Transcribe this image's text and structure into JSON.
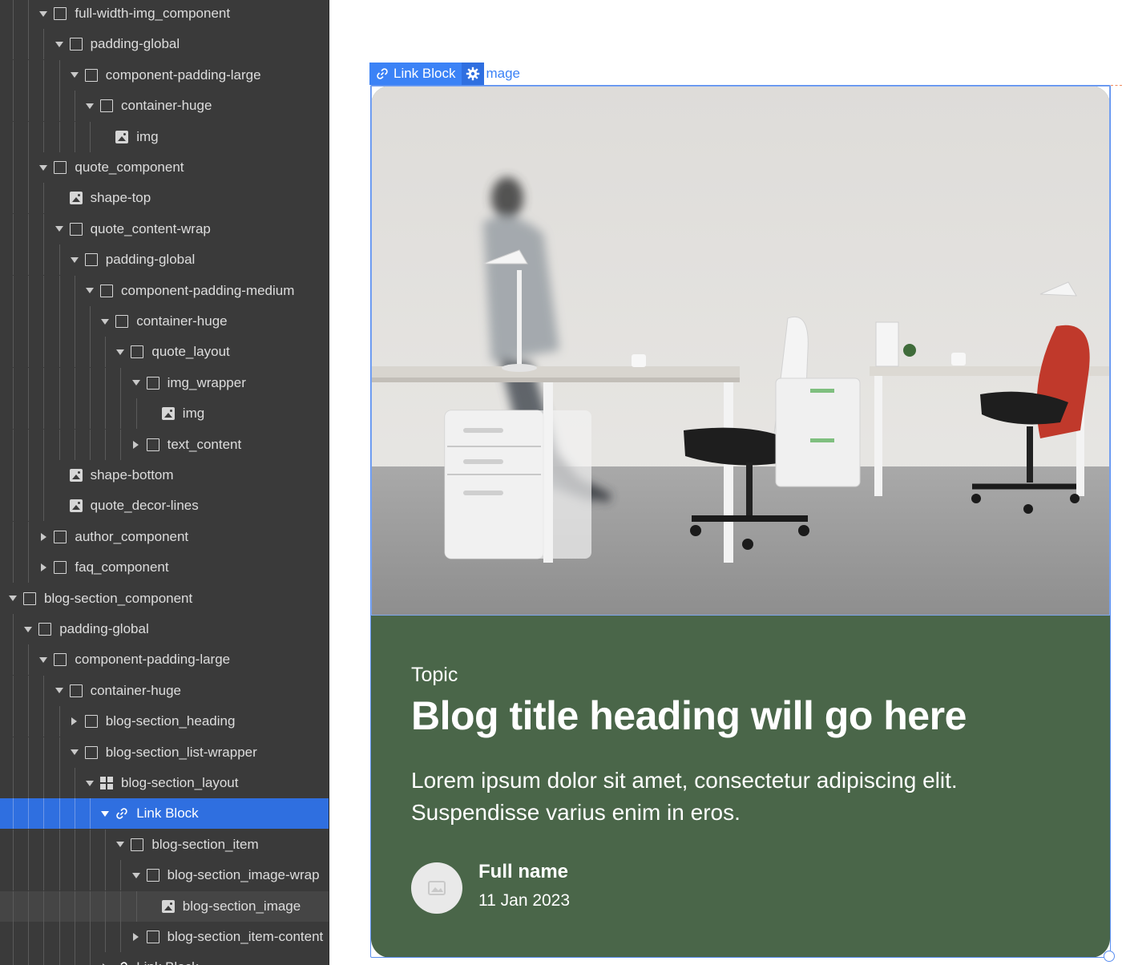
{
  "navigator": {
    "rows": [
      {
        "label": "full-width-img_component",
        "icon": "box-icon",
        "toggle": "down"
      },
      {
        "label": "padding-global",
        "icon": "box-icon",
        "toggle": "down"
      },
      {
        "label": "component-padding-large",
        "icon": "box-icon",
        "toggle": "down"
      },
      {
        "label": "container-huge",
        "icon": "box-icon",
        "toggle": "down"
      },
      {
        "label": "img",
        "icon": "image-icon",
        "toggle": "none"
      },
      {
        "label": "quote_component",
        "icon": "box-icon",
        "toggle": "down"
      },
      {
        "label": "shape-top",
        "icon": "image-icon",
        "toggle": "none"
      },
      {
        "label": "quote_content-wrap",
        "icon": "box-icon",
        "toggle": "down"
      },
      {
        "label": "padding-global",
        "icon": "box-icon",
        "toggle": "down"
      },
      {
        "label": "component-padding-medium",
        "icon": "box-icon",
        "toggle": "down"
      },
      {
        "label": "container-huge",
        "icon": "box-icon",
        "toggle": "down"
      },
      {
        "label": "quote_layout",
        "icon": "box-icon",
        "toggle": "down"
      },
      {
        "label": "img_wrapper",
        "icon": "box-icon",
        "toggle": "down"
      },
      {
        "label": "img",
        "icon": "image-icon",
        "toggle": "none"
      },
      {
        "label": "text_content",
        "icon": "box-icon",
        "toggle": "right"
      },
      {
        "label": "shape-bottom",
        "icon": "image-icon",
        "toggle": "none"
      },
      {
        "label": "quote_decor-lines",
        "icon": "image-icon",
        "toggle": "none"
      },
      {
        "label": "author_component",
        "icon": "box-icon",
        "toggle": "right"
      },
      {
        "label": "faq_component",
        "icon": "box-icon",
        "toggle": "right"
      },
      {
        "label": "blog-section_component",
        "icon": "box-icon",
        "toggle": "down"
      },
      {
        "label": "padding-global",
        "icon": "box-icon",
        "toggle": "down"
      },
      {
        "label": "component-padding-large",
        "icon": "box-icon",
        "toggle": "down"
      },
      {
        "label": "container-huge",
        "icon": "box-icon",
        "toggle": "down"
      },
      {
        "label": "blog-section_heading",
        "icon": "box-icon",
        "toggle": "right"
      },
      {
        "label": "blog-section_list-wrapper",
        "icon": "box-icon",
        "toggle": "down"
      },
      {
        "label": "blog-section_layout",
        "icon": "grid-icon",
        "toggle": "down"
      },
      {
        "label": "Link Block",
        "icon": "link-icon",
        "toggle": "down",
        "state": "selected"
      },
      {
        "label": "blog-section_item",
        "icon": "box-icon",
        "toggle": "down"
      },
      {
        "label": "blog-section_image-wrap",
        "icon": "box-icon",
        "toggle": "down"
      },
      {
        "label": "blog-section_image",
        "icon": "image-icon",
        "toggle": "none",
        "state": "hovered"
      },
      {
        "label": "blog-section_item-content",
        "icon": "box-icon",
        "toggle": "right"
      },
      {
        "label": "Link Block",
        "icon": "link-icon",
        "toggle": "right"
      }
    ]
  },
  "canvas": {
    "badge": {
      "label": "Link Block",
      "hint": "mage",
      "icon": "link-icon",
      "settings_icon": "gear-icon"
    },
    "card": {
      "topic": "Topic",
      "title": "Blog title heading will go here",
      "excerpt": "Lorem ipsum dolor sit amet, consectetur adipiscing elit. Suspendisse varius enim in eros.",
      "author_name": "Full name",
      "date": "11 Jan 2023",
      "avatar_icon": "image-placeholder-icon",
      "background_color": "#4a6649"
    },
    "colors": {
      "selection": "#3b82f6",
      "navigator_bg": "#3a3a3a",
      "navigator_selected": "#2f6fe0"
    }
  }
}
